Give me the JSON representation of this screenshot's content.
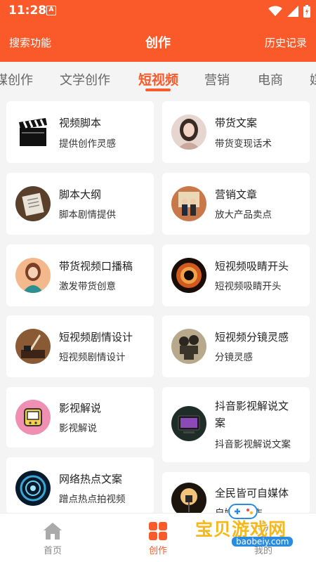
{
  "status": {
    "time": "11:28",
    "notification_letter": "A"
  },
  "header": {
    "search_label": "搜索功能",
    "title": "创作",
    "history_label": "历史记录"
  },
  "tabs": [
    {
      "label": "媒创作"
    },
    {
      "label": "文学创作"
    },
    {
      "label": "短视频",
      "active": true
    },
    {
      "label": "营销"
    },
    {
      "label": "电商"
    },
    {
      "label": "媒"
    }
  ],
  "cards": [
    {
      "title": "视频脚本",
      "subtitle": "提供创作灵感",
      "icon": "clapperboard-icon"
    },
    {
      "title": "带货文案",
      "subtitle": "带货变现话术",
      "icon": "woman-portrait-icon"
    },
    {
      "title": "脚本大纲",
      "subtitle": "脚本剧情提供",
      "icon": "script-book-icon"
    },
    {
      "title": "营销文章",
      "subtitle": "放大产品卖点",
      "icon": "business-people-icon"
    },
    {
      "title": "带货视频口播稿",
      "subtitle": "激发带货创意",
      "icon": "presenter-woman-icon"
    },
    {
      "title": "短视频吸睛开头",
      "subtitle": "短视频吸睛开头",
      "icon": "eye-icon"
    },
    {
      "title": "短视频剧情设计",
      "subtitle": "短视频剧情设计",
      "icon": "writing-desk-icon"
    },
    {
      "title": "短视频分镜灵感",
      "subtitle": "分镜灵感",
      "icon": "film-projector-icon"
    },
    {
      "title": "影视解说",
      "subtitle": "影视解说",
      "icon": "retro-tv-icon"
    },
    {
      "title_line1": "抖音影视解说文",
      "title_line2": "案",
      "subtitle": "抖音影视解说文案",
      "icon": "tv-screen-icon"
    },
    {
      "title": "网络热点文案",
      "subtitle": "蹭点热点拍视频",
      "icon": "tech-circle-icon"
    },
    {
      "title": "全民皆可自媒体",
      "subtitle": "自媒体创作",
      "icon": "camera-lamp-icon"
    }
  ],
  "bottom_nav": [
    {
      "label": "首页",
      "icon": "home-icon"
    },
    {
      "label": "创作",
      "icon": "grid-icon",
      "active": true
    },
    {
      "label": "我的",
      "icon": "user-icon"
    }
  ],
  "watermark": {
    "text": "宝贝游戏网",
    "url": "baobeiy.com"
  },
  "colors": {
    "accent": "#fa5a2a",
    "background": "#f4f4f4"
  }
}
